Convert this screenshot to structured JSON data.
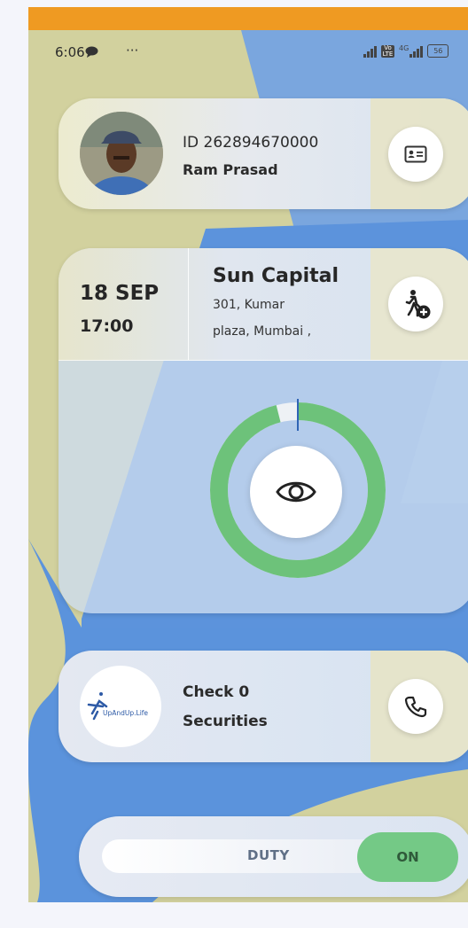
{
  "status_bar": {
    "time": "6:06",
    "more": "···",
    "network": "4G",
    "lte": "Vo LTE",
    "battery": "56"
  },
  "profile": {
    "id_text": "ID 262894670000",
    "name": "Ram Prasad",
    "id_card_icon": "id-card-icon"
  },
  "shift": {
    "date": "18 SEP",
    "time": "17:00",
    "site_name": "Sun Capital",
    "address_line1": "301, Kumar",
    "address_line2": "plaza, Mumbai ,",
    "add_visitor_icon": "person-walk-plus-icon",
    "progress_fraction": 0.96,
    "progress_color": "#6dc27a",
    "remaining_color": "#eef1f5",
    "view_icon": "eye-icon"
  },
  "check": {
    "logo_text": "UpAndUp.Life",
    "line1": "Check 0",
    "line2": "Securities",
    "call_icon": "phone-icon"
  },
  "duty": {
    "label": "DUTY",
    "toggle_label": "ON",
    "toggle_color": "#74c986"
  },
  "colors": {
    "top_bar": "#ef9a22",
    "bg_khaki": "#d2d19e",
    "bg_blue": "#5b93dc"
  }
}
